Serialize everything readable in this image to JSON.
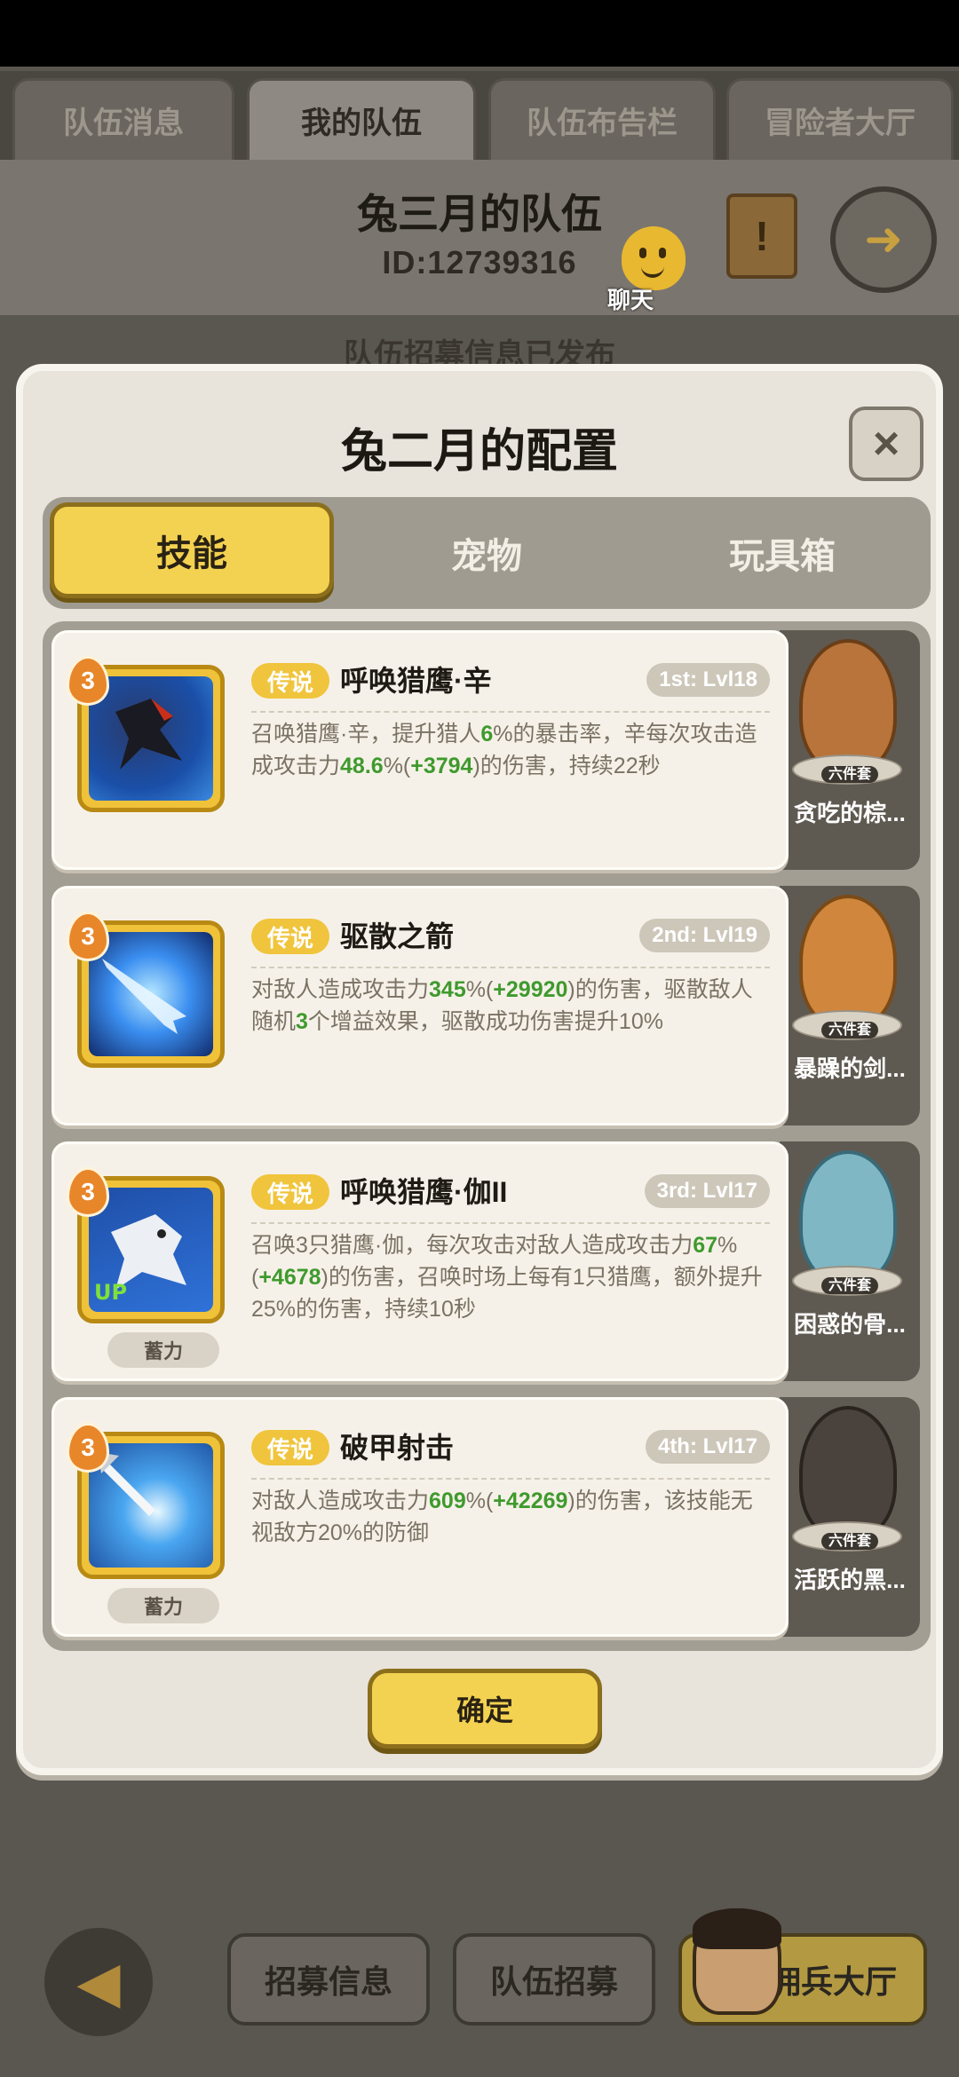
{
  "top_tabs": [
    {
      "label": "队伍消息",
      "active": false
    },
    {
      "label": "我的队伍",
      "active": true
    },
    {
      "label": "队伍布告栏",
      "active": false
    },
    {
      "label": "冒险者大厅",
      "active": false
    }
  ],
  "team": {
    "title": "兔三月的队伍",
    "id": "ID:12739316",
    "chat_label": "聊天",
    "notice": "队伍招募信息已发布"
  },
  "modal": {
    "title": "兔二月的配置",
    "close_icon": "×",
    "tabs": [
      {
        "label": "技能",
        "active": true
      },
      {
        "label": "宠物",
        "active": false
      },
      {
        "label": "玩具箱",
        "active": false
      }
    ],
    "skills": [
      {
        "level": "3",
        "rarity": "传说",
        "name": "呼唤猎鹰·辛",
        "slot": "1st: Lvl18",
        "charge": "",
        "desc_parts": [
          "召唤猎鹰·辛，提升猎人",
          "6",
          "%的暴击率，辛每次攻击造成攻击力",
          "48.6",
          "%(",
          "+3794",
          ")的伤害，持续22秒"
        ]
      },
      {
        "level": "3",
        "rarity": "传说",
        "name": "驱散之箭",
        "slot": "2nd: Lvl19",
        "charge": "",
        "desc_parts": [
          "对敌人造成攻击力",
          "345",
          "%(",
          "+29920",
          ")的伤害，驱散敌人随机",
          "3",
          "个增益效果，驱散成功伤害提升10%"
        ]
      },
      {
        "level": "3",
        "rarity": "传说",
        "name": "呼唤猎鹰·伽II",
        "slot": "3rd: Lvl17",
        "charge": "蓄力",
        "desc_parts": [
          "召唤3只猎鹰·伽，每次攻击对敌人造成攻击力",
          "67",
          "%(",
          "+4678",
          ")的伤害，召唤时场上每有1只猎鹰，额外提升25%的伤害，持续10秒"
        ]
      },
      {
        "level": "3",
        "rarity": "传说",
        "name": "破甲射击",
        "slot": "4th: Lvl17",
        "charge": "蓄力",
        "desc_parts": [
          "对敌人造成攻击力",
          "609",
          "%(",
          "+42269",
          ")的伤害，该技能无视敌方20%的防御"
        ]
      }
    ],
    "pets": [
      {
        "name": "贪吃的棕...",
        "set": "六件套",
        "color": "#b8743a"
      },
      {
        "name": "暴躁的剑...",
        "set": "六件套",
        "color": "#d0863c"
      },
      {
        "name": "困惑的骨...",
        "set": "六件套",
        "color": "#7fb7c4"
      },
      {
        "name": "活跃的黑...",
        "set": "六件套",
        "color": "#4a423c"
      }
    ],
    "confirm_label": "确定"
  },
  "bottom": {
    "recruit_info": "招募信息",
    "team_recruit": "队伍招募",
    "merc_hall": "佣兵大厅"
  }
}
